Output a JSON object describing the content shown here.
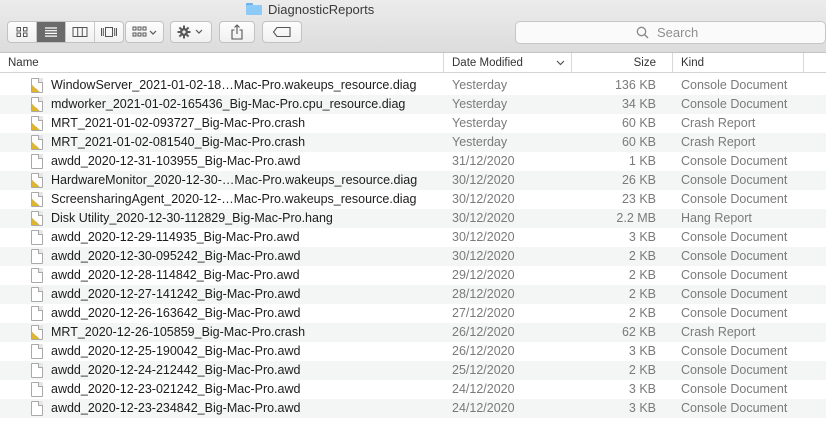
{
  "window": {
    "title": "DiagnosticReports"
  },
  "toolbar": {
    "view_icons": [
      "icon-view-icon",
      "list-view-icon",
      "column-view-icon",
      "gallery-view-icon"
    ],
    "search_placeholder": "Search"
  },
  "columns": {
    "name": "Name",
    "date": "Date Modified",
    "size": "Size",
    "kind": "Kind"
  },
  "rows": [
    {
      "name": "WindowServer_2021-01-02-18…Mac-Pro.wakeups_resource.diag",
      "date": "Yesterday",
      "size": "136 KB",
      "kind": "Console Document",
      "icon": "warn"
    },
    {
      "name": "mdworker_2021-01-02-165436_Big-Mac-Pro.cpu_resource.diag",
      "date": "Yesterday",
      "size": "34 KB",
      "kind": "Console Document",
      "icon": "warn"
    },
    {
      "name": "MRT_2021-01-02-093727_Big-Mac-Pro.crash",
      "date": "Yesterday",
      "size": "60 KB",
      "kind": "Crash Report",
      "icon": "warn"
    },
    {
      "name": "MRT_2021-01-02-081540_Big-Mac-Pro.crash",
      "date": "Yesterday",
      "size": "60 KB",
      "kind": "Crash Report",
      "icon": "warn"
    },
    {
      "name": "awdd_2020-12-31-103955_Big-Mac-Pro.awd",
      "date": "31/12/2020",
      "size": "1 KB",
      "kind": "Console Document",
      "icon": "plain"
    },
    {
      "name": "HardwareMonitor_2020-12-30-…Mac-Pro.wakeups_resource.diag",
      "date": "30/12/2020",
      "size": "26 KB",
      "kind": "Console Document",
      "icon": "warn"
    },
    {
      "name": "ScreensharingAgent_2020-12-…Mac-Pro.wakeups_resource.diag",
      "date": "30/12/2020",
      "size": "23 KB",
      "kind": "Console Document",
      "icon": "warn"
    },
    {
      "name": "Disk Utility_2020-12-30-112829_Big-Mac-Pro.hang",
      "date": "30/12/2020",
      "size": "2.2 MB",
      "kind": "Hang Report",
      "icon": "warn"
    },
    {
      "name": "awdd_2020-12-29-114935_Big-Mac-Pro.awd",
      "date": "30/12/2020",
      "size": "3 KB",
      "kind": "Console Document",
      "icon": "plain"
    },
    {
      "name": "awdd_2020-12-30-095242_Big-Mac-Pro.awd",
      "date": "30/12/2020",
      "size": "2 KB",
      "kind": "Console Document",
      "icon": "plain"
    },
    {
      "name": "awdd_2020-12-28-114842_Big-Mac-Pro.awd",
      "date": "29/12/2020",
      "size": "2 KB",
      "kind": "Console Document",
      "icon": "plain"
    },
    {
      "name": "awdd_2020-12-27-141242_Big-Mac-Pro.awd",
      "date": "28/12/2020",
      "size": "2 KB",
      "kind": "Console Document",
      "icon": "plain"
    },
    {
      "name": "awdd_2020-12-26-163642_Big-Mac-Pro.awd",
      "date": "27/12/2020",
      "size": "2 KB",
      "kind": "Console Document",
      "icon": "plain"
    },
    {
      "name": "MRT_2020-12-26-105859_Big-Mac-Pro.crash",
      "date": "26/12/2020",
      "size": "62 KB",
      "kind": "Crash Report",
      "icon": "warn"
    },
    {
      "name": "awdd_2020-12-25-190042_Big-Mac-Pro.awd",
      "date": "26/12/2020",
      "size": "3 KB",
      "kind": "Console Document",
      "icon": "plain"
    },
    {
      "name": "awdd_2020-12-24-212442_Big-Mac-Pro.awd",
      "date": "25/12/2020",
      "size": "2 KB",
      "kind": "Console Document",
      "icon": "plain"
    },
    {
      "name": "awdd_2020-12-23-021242_Big-Mac-Pro.awd",
      "date": "24/12/2020",
      "size": "3 KB",
      "kind": "Console Document",
      "icon": "plain"
    },
    {
      "name": "awdd_2020-12-23-234842_Big-Mac-Pro.awd",
      "date": "24/12/2020",
      "size": "3 KB",
      "kind": "Console Document",
      "icon": "plain"
    }
  ]
}
